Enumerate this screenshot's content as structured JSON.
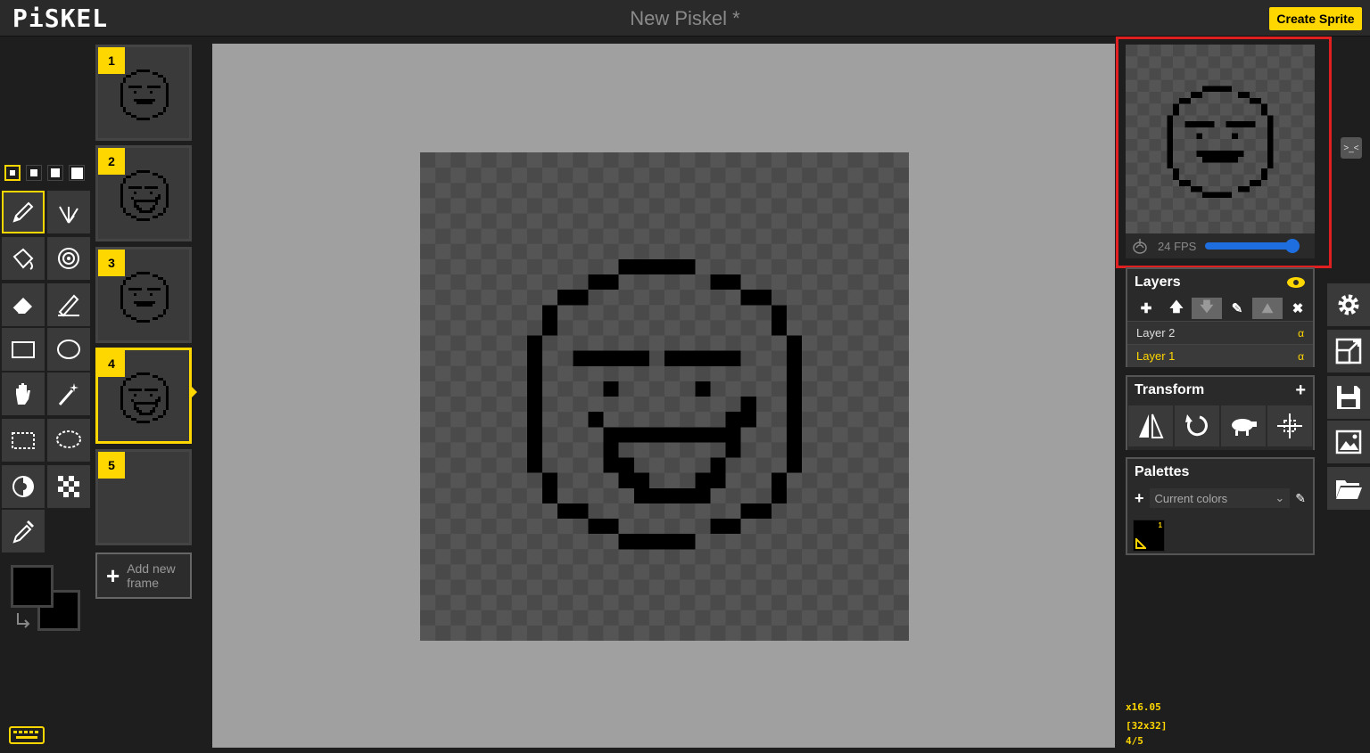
{
  "app": {
    "logo": "PiSKEL",
    "title": "New Piskel *",
    "create_label": "Create Sprite"
  },
  "colors": {
    "accent": "#ffd700",
    "canvas_bg": "#a0a0a0",
    "highlight": "#e02020",
    "slider": "#1e6ee0"
  },
  "tools": {
    "pen_sizes": [
      1,
      2,
      3,
      4
    ],
    "selected_pen_size": 1,
    "items": [
      "pen-tool",
      "vertical-mirror-pen",
      "paint-bucket",
      "paint-same-pixels",
      "eraser",
      "stroke-tool",
      "rectangle",
      "circle",
      "move",
      "shape-selection",
      "rectangle-selection",
      "lasso-selection",
      "lighten",
      "dithering",
      "color-picker"
    ]
  },
  "frames": [
    {
      "num": "1",
      "face": "neutral"
    },
    {
      "num": "2",
      "face": "tongue"
    },
    {
      "num": "3",
      "face": "neutral"
    },
    {
      "num": "4",
      "face": "tongue",
      "selected": true
    },
    {
      "num": "5",
      "face": "empty"
    }
  ],
  "add_frame": {
    "line1": "Add new",
    "line2": "frame"
  },
  "preview": {
    "fps_label": "24 FPS",
    "fps": 24
  },
  "layers": {
    "title": "Layers",
    "items": [
      {
        "name": "Layer 2",
        "alpha": "α"
      },
      {
        "name": "Layer 1",
        "alpha": "α",
        "active": true
      }
    ]
  },
  "transform": {
    "title": "Transform"
  },
  "palettes": {
    "title": "Palettes",
    "selected": "Current colors",
    "swatch_index": "1"
  },
  "status": {
    "zoom": "x16.05",
    "size": "[32x32]",
    "frame": "4/5"
  }
}
